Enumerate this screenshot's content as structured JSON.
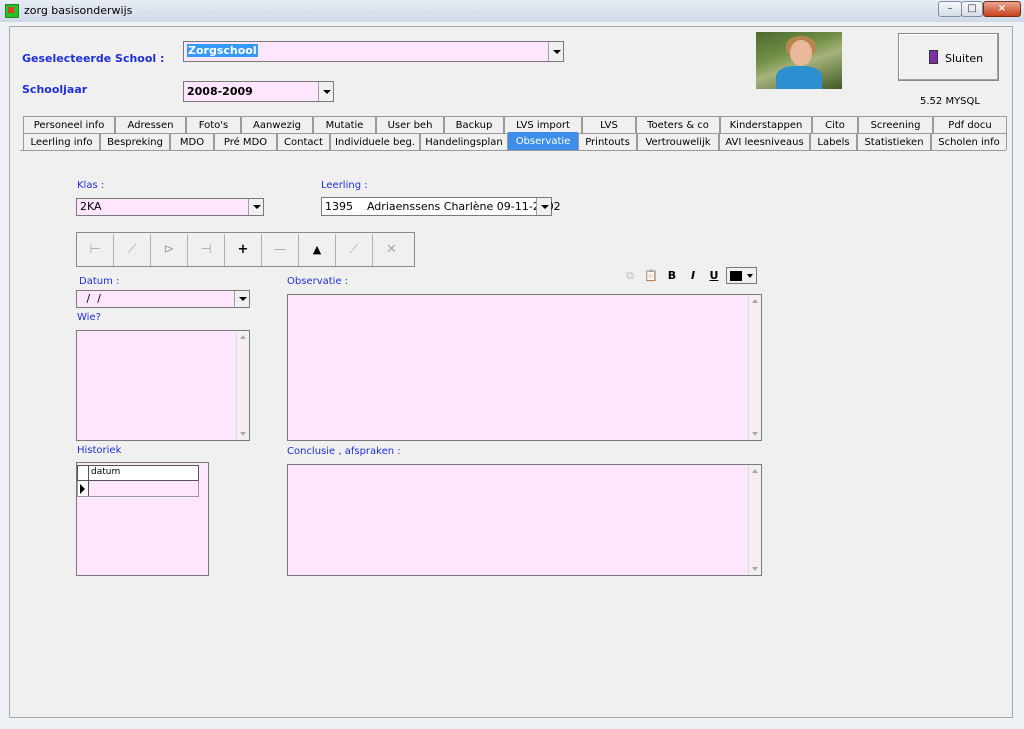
{
  "window": {
    "title": "zorg basisonderwijs",
    "ghost_menu": [
      "...",
      "...",
      "...",
      "...",
      "...",
      "...",
      "..."
    ],
    "controls": {
      "minimize": "–",
      "maximize": "□",
      "close": "×"
    }
  },
  "header": {
    "school_label": "Geselecteerde School :",
    "school_value": "Zorgschool",
    "year_label": "Schooljaar",
    "year_value": "2008-2009",
    "close_button": "Sluiten",
    "version": "5.52 MYSQL"
  },
  "tabs_row1": [
    "Personeel info",
    "Adressen",
    "Foto's",
    "Aanwezig",
    "Mutatie",
    "User beh",
    "Backup",
    "LVS import",
    "LVS",
    "Toeters & co",
    "Kinderstappen",
    "Cito",
    "Screening",
    "Pdf docu"
  ],
  "tabs_row2": [
    "Leerling info",
    "Bespreking",
    "MDO",
    "Pré MDO",
    "Contact",
    "Individuele beg.",
    "Handelingsplan",
    "Observatie",
    "Printouts",
    "Vertrouwelijk",
    "AVI leesniveaus",
    "Labels",
    "Statistieken",
    "Scholen info"
  ],
  "active_tab": "Observatie",
  "form": {
    "klas_label": "Klas :",
    "klas_value": "2KA",
    "leerling_label": "Leerling :",
    "leerling_value": "1395    Adriaenssens Charlène 09-11-2002",
    "datum_label": "Datum :",
    "datum_value": " /  /",
    "wie_label": "Wie?",
    "observatie_label": "Observatie :",
    "historiek_label": "Historiek",
    "historiek_column": "datum",
    "conclusie_label": "Conclusie , afspraken :"
  },
  "toolbar": {
    "buttons": [
      {
        "icon": "first-record-icon",
        "glyph": "⊢"
      },
      {
        "icon": "previous-record-icon",
        "glyph": "⟋"
      },
      {
        "icon": "next-record-icon",
        "glyph": "⊳"
      },
      {
        "icon": "last-record-icon",
        "glyph": "⊣"
      },
      {
        "icon": "add-record-icon",
        "glyph": "+"
      },
      {
        "icon": "delete-record-icon",
        "glyph": "—"
      },
      {
        "icon": "save-record-icon",
        "glyph": "▲"
      },
      {
        "icon": "edit-record-icon",
        "glyph": "⟋"
      },
      {
        "icon": "cancel-record-icon",
        "glyph": "✕"
      }
    ]
  },
  "format_toolbar": {
    "bold": "B",
    "italic": "I",
    "underline": "U",
    "text_color": "#000000"
  },
  "colors": {
    "field_bg": "#ffe6ff",
    "label": "#1f2fd8",
    "active_tab": "#3d8ee8"
  }
}
